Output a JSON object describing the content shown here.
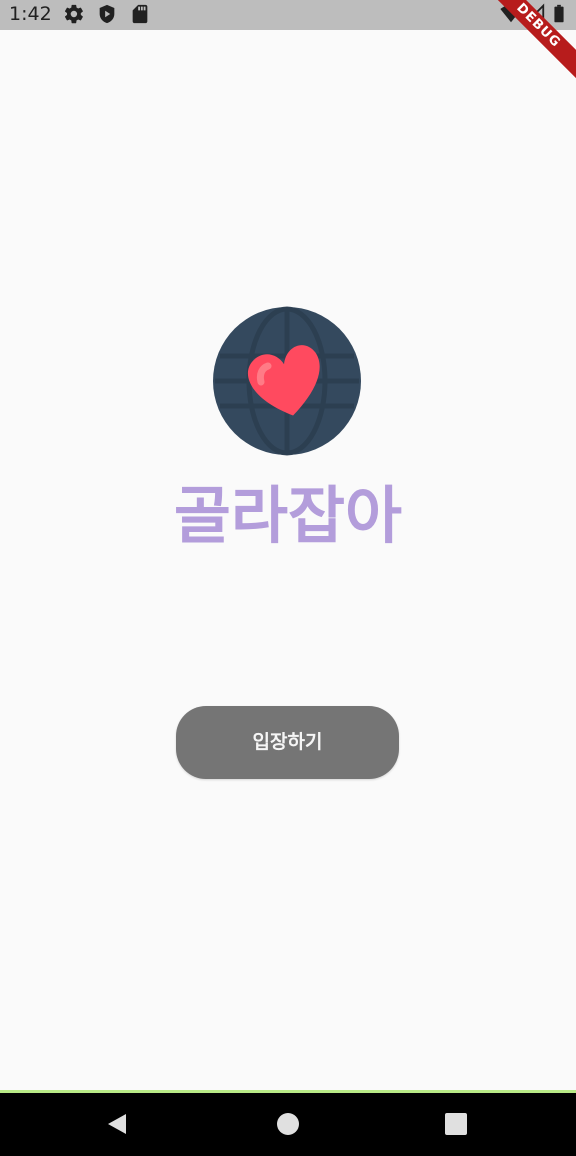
{
  "status_bar": {
    "time": "1:42",
    "left_icons": [
      "gear-icon",
      "play-protect-icon",
      "sd-card-icon"
    ],
    "right_icons": [
      "wifi-icon",
      "cell-signal-icon",
      "battery-icon"
    ]
  },
  "debug_banner": {
    "label": "DEBUG"
  },
  "logo": {
    "icon": "globe-heart-icon",
    "colors": {
      "globe": "#34495e",
      "globe_lines": "#2c3e50",
      "heart": "#ff4a5f",
      "heart_highlight": "#ff7b86"
    }
  },
  "app": {
    "title": "골라잡아",
    "title_color": "#b39ddb"
  },
  "enter_button": {
    "label": "입장하기",
    "background": "#757575"
  },
  "nav_bar": {
    "buttons": [
      "back-icon",
      "home-icon",
      "recents-icon"
    ]
  }
}
